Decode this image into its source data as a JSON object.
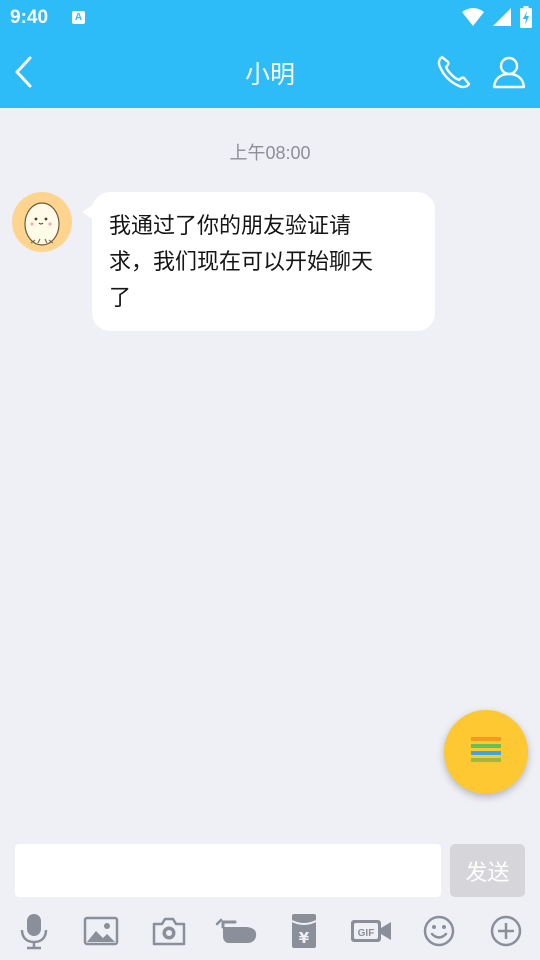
{
  "status_bar": {
    "time": "9:40",
    "notification_letter": "A"
  },
  "header": {
    "title": "小明",
    "back_icon": "chevron-left-icon",
    "call_icon": "phone-icon",
    "profile_icon": "user-icon",
    "color": "#2ebcf9"
  },
  "chat": {
    "timestamp": "上午08:00",
    "messages": [
      {
        "sender_avatar": "egg-avatar",
        "lines": [
          "我通过了你的朋友验证请",
          "求，我们现在可以开始聊天",
          "了"
        ]
      }
    ]
  },
  "fab": {
    "icon": "stacked-menu-icon",
    "color": "#fdc831"
  },
  "composer": {
    "input_value": "",
    "send_label": "发送"
  },
  "toolbar": {
    "icons": [
      "microphone-icon",
      "image-icon",
      "camera-icon",
      "poke-hand-icon",
      "red-packet-icon",
      "gif-icon",
      "emoji-icon",
      "add-icon"
    ]
  }
}
